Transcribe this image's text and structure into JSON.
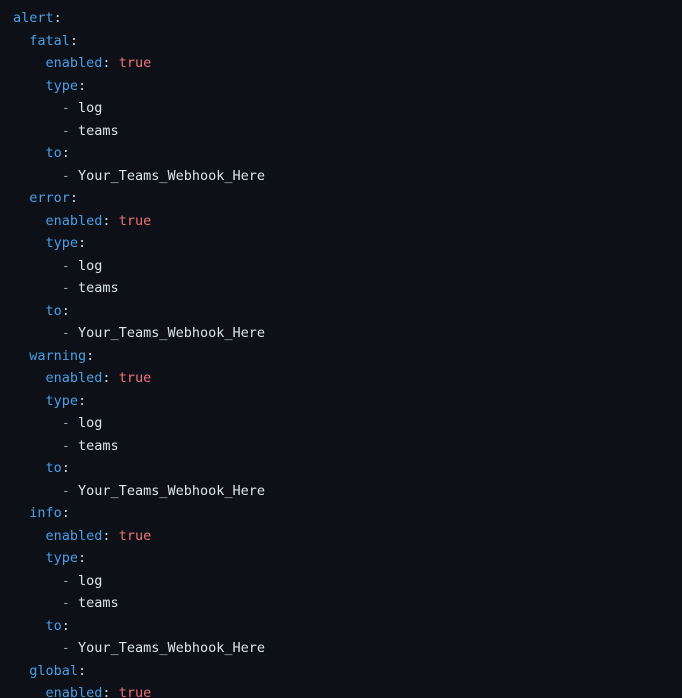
{
  "editor": {
    "language": "yaml",
    "background_color": "#0d1117",
    "colors": {
      "key": "#4a9fe8",
      "colon": "#c9d6e4",
      "boolean": "#f07178",
      "dash": "#8b9bb4",
      "value": "#dce3ec"
    }
  },
  "document": {
    "lines": [
      {
        "indent": 0,
        "type": "key",
        "key": "alert",
        "colon": ":",
        "value": ""
      },
      {
        "indent": 1,
        "type": "key",
        "key": "fatal",
        "colon": ":",
        "value": ""
      },
      {
        "indent": 2,
        "type": "bool",
        "key": "enabled",
        "colon": ":",
        "value": "true"
      },
      {
        "indent": 2,
        "type": "key",
        "key": "type",
        "colon": ":",
        "value": ""
      },
      {
        "indent": 3,
        "type": "item",
        "key": "",
        "colon": "",
        "value": "log"
      },
      {
        "indent": 3,
        "type": "item",
        "key": "",
        "colon": "",
        "value": "teams"
      },
      {
        "indent": 2,
        "type": "key",
        "key": "to",
        "colon": ":",
        "value": ""
      },
      {
        "indent": 3,
        "type": "item",
        "key": "",
        "colon": "",
        "value": "Your_Teams_Webhook_Here"
      },
      {
        "indent": 1,
        "type": "key",
        "key": "error",
        "colon": ":",
        "value": ""
      },
      {
        "indent": 2,
        "type": "bool",
        "key": "enabled",
        "colon": ":",
        "value": "true"
      },
      {
        "indent": 2,
        "type": "key",
        "key": "type",
        "colon": ":",
        "value": ""
      },
      {
        "indent": 3,
        "type": "item",
        "key": "",
        "colon": "",
        "value": "log"
      },
      {
        "indent": 3,
        "type": "item",
        "key": "",
        "colon": "",
        "value": "teams"
      },
      {
        "indent": 2,
        "type": "key",
        "key": "to",
        "colon": ":",
        "value": ""
      },
      {
        "indent": 3,
        "type": "item",
        "key": "",
        "colon": "",
        "value": "Your_Teams_Webhook_Here"
      },
      {
        "indent": 1,
        "type": "key",
        "key": "warning",
        "colon": ":",
        "value": ""
      },
      {
        "indent": 2,
        "type": "bool",
        "key": "enabled",
        "colon": ":",
        "value": "true"
      },
      {
        "indent": 2,
        "type": "key",
        "key": "type",
        "colon": ":",
        "value": ""
      },
      {
        "indent": 3,
        "type": "item",
        "key": "",
        "colon": "",
        "value": "log"
      },
      {
        "indent": 3,
        "type": "item",
        "key": "",
        "colon": "",
        "value": "teams"
      },
      {
        "indent": 2,
        "type": "key",
        "key": "to",
        "colon": ":",
        "value": ""
      },
      {
        "indent": 3,
        "type": "item",
        "key": "",
        "colon": "",
        "value": "Your_Teams_Webhook_Here"
      },
      {
        "indent": 1,
        "type": "key",
        "key": "info",
        "colon": ":",
        "value": ""
      },
      {
        "indent": 2,
        "type": "bool",
        "key": "enabled",
        "colon": ":",
        "value": "true"
      },
      {
        "indent": 2,
        "type": "key",
        "key": "type",
        "colon": ":",
        "value": ""
      },
      {
        "indent": 3,
        "type": "item",
        "key": "",
        "colon": "",
        "value": "log"
      },
      {
        "indent": 3,
        "type": "item",
        "key": "",
        "colon": "",
        "value": "teams"
      },
      {
        "indent": 2,
        "type": "key",
        "key": "to",
        "colon": ":",
        "value": ""
      },
      {
        "indent": 3,
        "type": "item",
        "key": "",
        "colon": "",
        "value": "Your_Teams_Webhook_Here"
      },
      {
        "indent": 1,
        "type": "key",
        "key": "global",
        "colon": ":",
        "value": ""
      },
      {
        "indent": 2,
        "type": "bool",
        "key": "enabled",
        "colon": ":",
        "value": "true"
      }
    ]
  }
}
